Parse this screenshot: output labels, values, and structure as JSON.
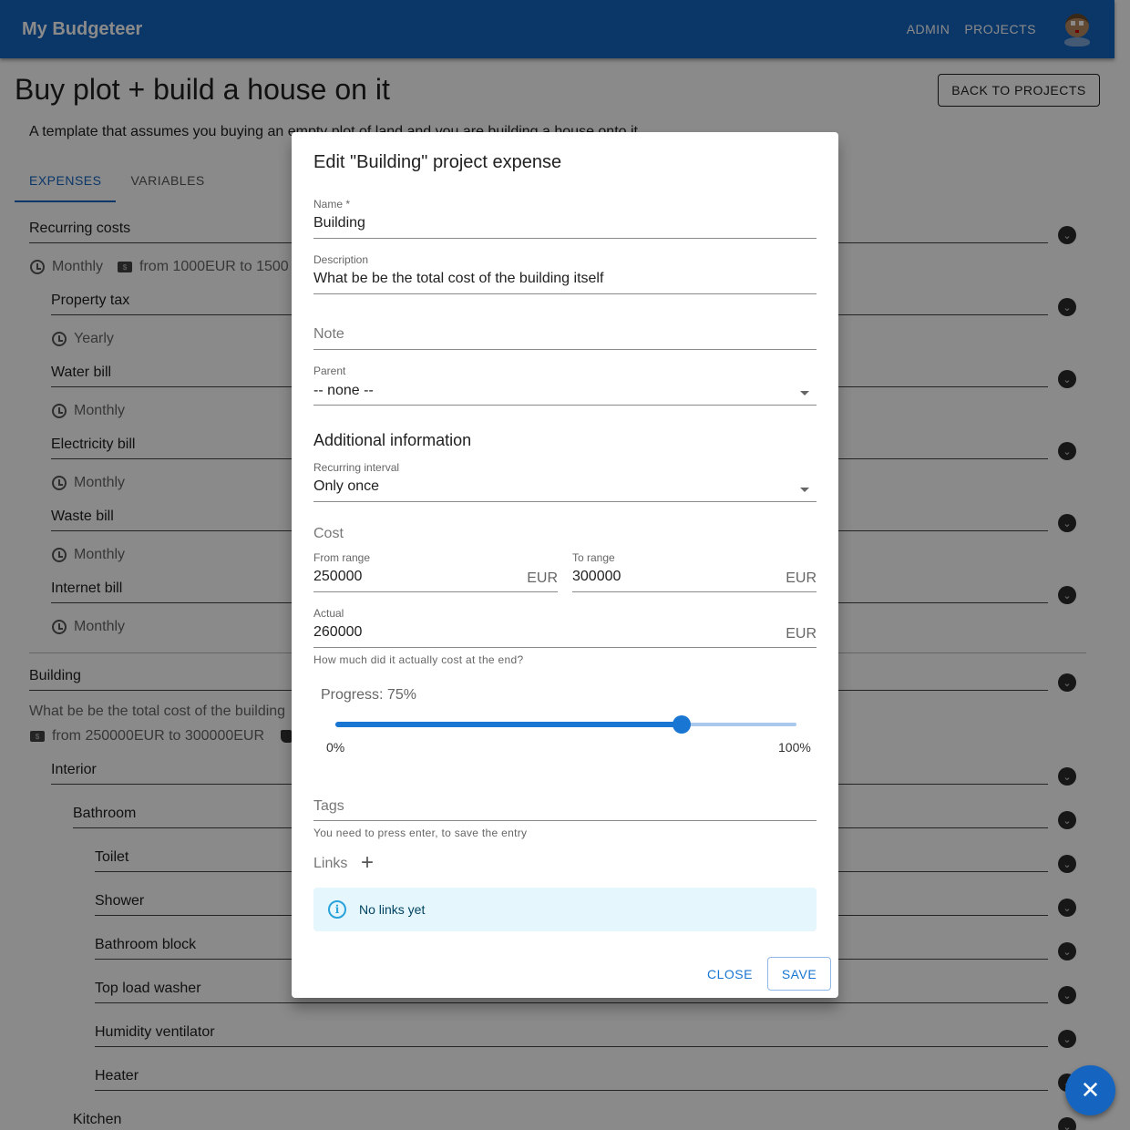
{
  "app": {
    "brand": "My Budgeteer",
    "nav": [
      "ADMIN",
      "PROJECTS"
    ],
    "brand_color": "#1565c0"
  },
  "page": {
    "title": "Buy plot + build a house on it",
    "back_button": "BACK TO PROJECTS",
    "description": "A template that assumes you buying an empty plot of land and you are building a house onto it",
    "tabs": [
      {
        "label": "EXPENSES",
        "active": true
      },
      {
        "label": "VARIABLES",
        "active": false
      }
    ]
  },
  "expenses": [
    {
      "name": "Recurring costs",
      "meta_interval": "Monthly",
      "meta_cost": "from 1000EUR to 1500"
    },
    {
      "name": "Property tax",
      "meta_interval": "Yearly"
    },
    {
      "name": "Water bill",
      "meta_interval": "Monthly"
    },
    {
      "name": "Electricity bill",
      "meta_interval": "Monthly"
    },
    {
      "name": "Waste bill",
      "meta_interval": "Monthly"
    },
    {
      "name": "Internet bill",
      "meta_interval": "Monthly"
    },
    {
      "name": "Building",
      "meta_description": "What be be the total cost of the building",
      "meta_cost": "from 250000EUR to 300000EUR"
    },
    {
      "name": "Interior"
    },
    {
      "name": "Bathroom"
    },
    {
      "name": "Toilet"
    },
    {
      "name": "Shower"
    },
    {
      "name": "Bathroom block"
    },
    {
      "name": "Top load washer"
    },
    {
      "name": "Humidity ventilator"
    },
    {
      "name": "Heater"
    },
    {
      "name": "Kitchen"
    }
  ],
  "dialog": {
    "title": "Edit \"Building\" project expense",
    "name_label": "Name *",
    "name_value": "Building",
    "description_label": "Description",
    "description_value": "What be be the total cost of the building itself",
    "note_placeholder": "Note",
    "parent_label": "Parent",
    "parent_value": "-- none --",
    "additional_title": "Additional information",
    "interval_label": "Recurring interval",
    "interval_value": "Only once",
    "cost_title": "Cost",
    "from_label": "From range",
    "from_value": "250000",
    "to_label": "To range",
    "to_value": "300000",
    "currency": "EUR",
    "actual_label": "Actual",
    "actual_value": "260000",
    "actual_hint": "How much did it actually cost at the end?",
    "progress_label": "Progress: 75%",
    "progress_value": 75,
    "progress_min": "0%",
    "progress_max": "100%",
    "tags_placeholder": "Tags",
    "tags_hint": "You need to press enter, to save the entry",
    "links_label": "Links",
    "links_empty": "No links yet",
    "close_button": "CLOSE",
    "save_button": "SAVE"
  }
}
